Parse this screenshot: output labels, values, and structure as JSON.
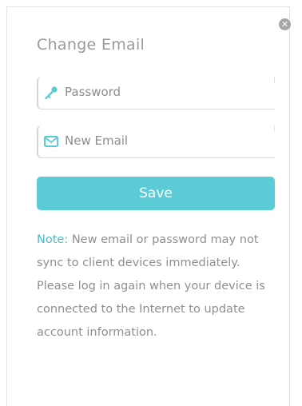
{
  "dialog": {
    "title": "Change Email",
    "close_icon_glyph": "✕",
    "password_field": {
      "icon": "key-icon",
      "placeholder": "Password"
    },
    "email_field": {
      "icon": "envelope-icon",
      "placeholder": "New Email"
    },
    "save_label": "Save",
    "note": {
      "label": "Note:",
      "text": " New email or password may not sync to client devices immediately. Please log in again when your device is connected to the Internet to update account information."
    }
  },
  "colors": {
    "accent": "#5bcbd6",
    "note_label": "#4fb9c8",
    "text": "#9a9a9a"
  }
}
